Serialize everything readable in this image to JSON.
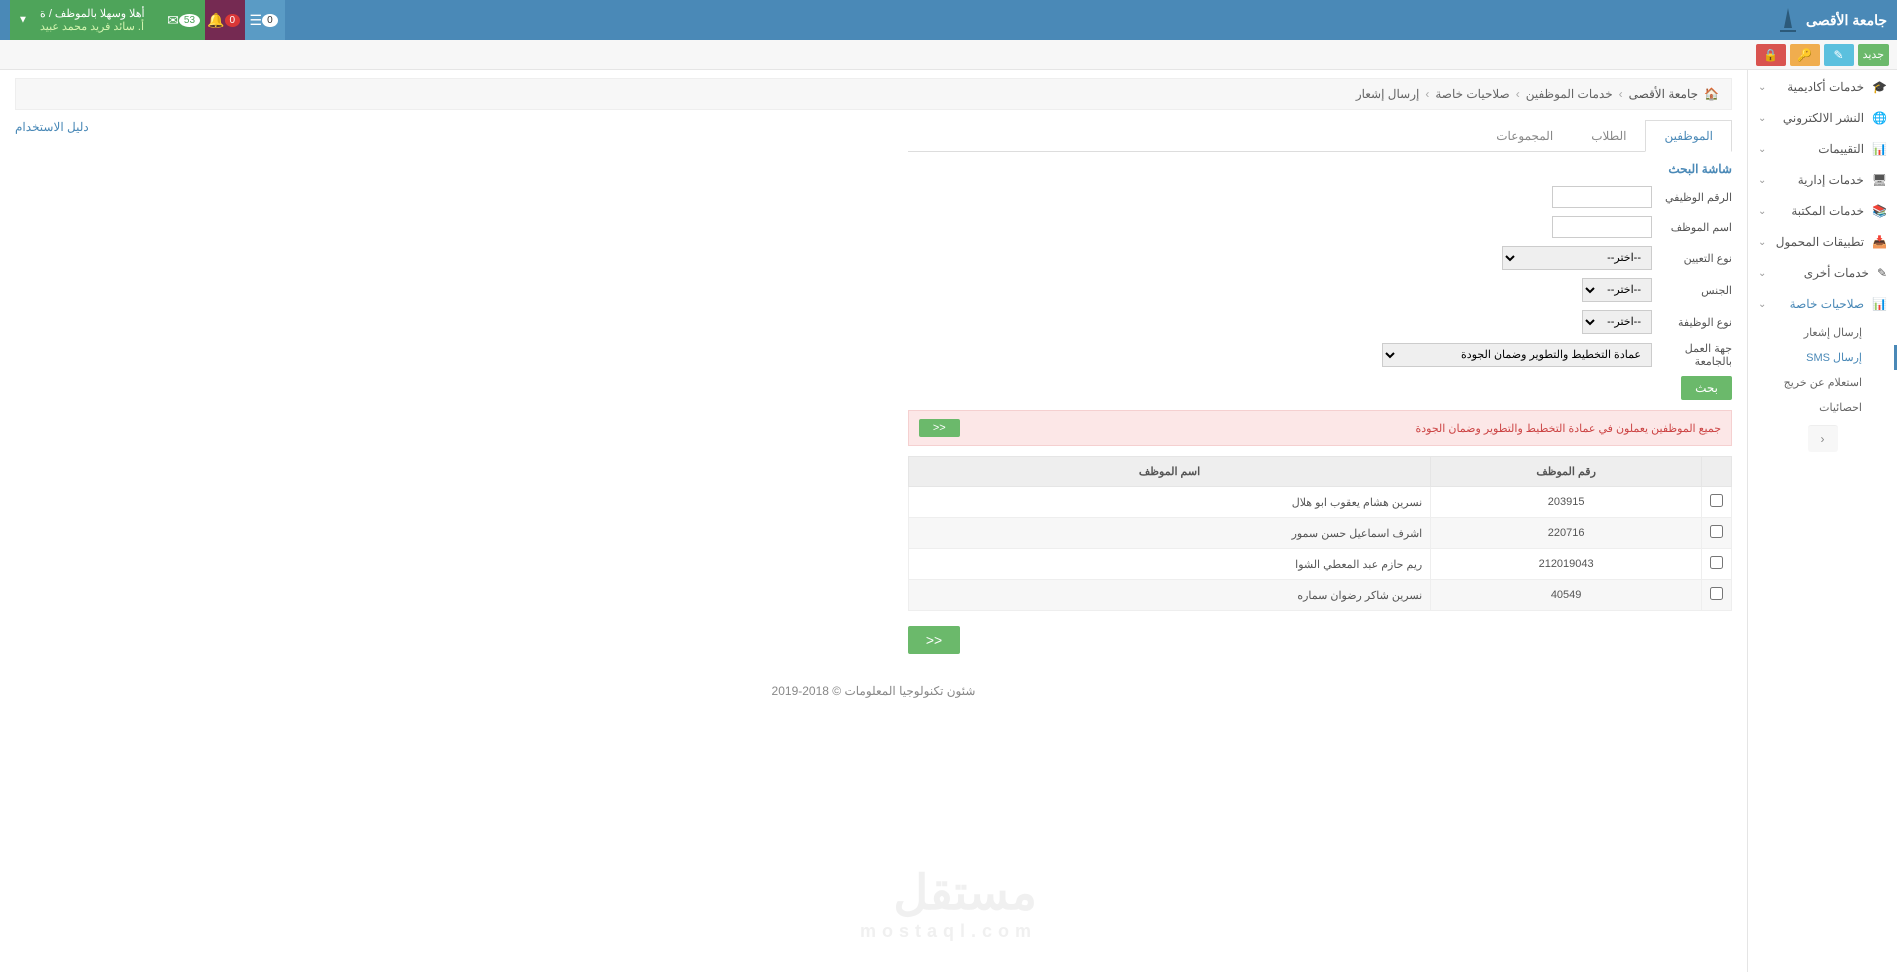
{
  "header": {
    "logo_text": "جامعة الأقصى",
    "welcome": "أهلا وسهلا بالموظف / ة",
    "user_name": "أ. سائد فريد محمد عبيد",
    "badge_bell": "0",
    "badge_env": "53",
    "badge_bars": "0"
  },
  "toolbar": {
    "new_label": "جديد"
  },
  "sidebar": {
    "items": [
      {
        "label": "خدمات أكاديمية",
        "icon": "🎓"
      },
      {
        "label": "النشر الالكتروني",
        "icon": "🌐"
      },
      {
        "label": "التقييمات",
        "icon": "📊"
      },
      {
        "label": "خدمات إدارية",
        "icon": "🖥"
      },
      {
        "label": "خدمات المكتبة",
        "icon": "📚"
      },
      {
        "label": "تطبيقات المحمول",
        "icon": "📥"
      },
      {
        "label": "خدمات أخرى",
        "icon": "✎"
      },
      {
        "label": "صلاحيات خاصة",
        "icon": "📊"
      }
    ],
    "submenu": [
      {
        "label": "إرسال إشعار"
      },
      {
        "label": "إرسال SMS"
      },
      {
        "label": "استعلام عن خريج"
      },
      {
        "label": "احصائيات"
      }
    ]
  },
  "breadcrumb": {
    "home": "جامعة الأقصى",
    "level1": "خدمات الموظفين",
    "level2": "صلاحيات خاصة",
    "level3": "إرسال إشعار"
  },
  "tabs": [
    {
      "label": "الموظفين"
    },
    {
      "label": "الطلاب"
    },
    {
      "label": "المجموعات"
    }
  ],
  "search": {
    "title": "شاشة البحث",
    "fields": {
      "emp_id": "الرقم الوظيفي",
      "emp_name": "اسم الموظف",
      "appoint_type": "نوع التعيين",
      "gender": "الجنس",
      "job_type": "نوع الوظيفة",
      "dept": "جهة العمل بالجامعة"
    },
    "default_option": "--اختر--",
    "dept_value": "عمادة التخطيط والتطوير وضمان الجودة",
    "btn": "بحث"
  },
  "alert": {
    "text": "جميع الموظفين يعملون في عمادة التخطيط والتطوير وضمان الجودة",
    "btn": "<<"
  },
  "table": {
    "col_id": "رقم الموظف",
    "col_name": "اسم الموظف",
    "rows": [
      {
        "id": "203915",
        "name": "نسرين هشام يعقوب ابو هلال"
      },
      {
        "id": "220716",
        "name": "اشرف اسماعيل حسن سمور"
      },
      {
        "id": "212019043",
        "name": "ريم حازم عبد المعطي الشوا"
      },
      {
        "id": "40549",
        "name": "نسرين شاكر رضوان سماره"
      }
    ]
  },
  "bottom_btn": "<<",
  "usage_guide": "دليل الاستخدام",
  "footer": "شئون تكنولوجيا المعلومات © 2018-2019",
  "watermark": {
    "main": "مستقل",
    "sub": "mostaql.com"
  }
}
